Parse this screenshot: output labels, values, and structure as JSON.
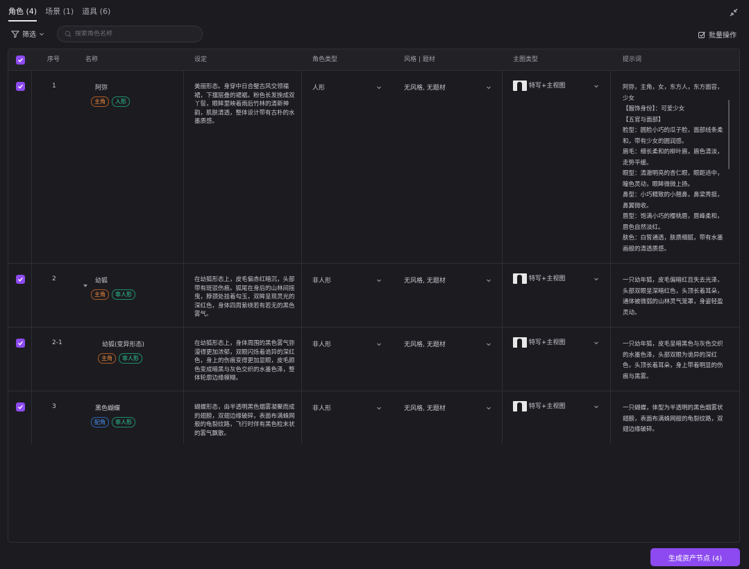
{
  "tabs": [
    {
      "label": "角色 (4)",
      "active": true
    },
    {
      "label": "场景 (1)",
      "active": false
    },
    {
      "label": "道具 (6)",
      "active": false
    }
  ],
  "toolbar": {
    "filter_label": "筛选",
    "search_placeholder": "搜索角色名称",
    "batch_label": "批量操作"
  },
  "columns": [
    "序号",
    "名称",
    "设定",
    "角色类型",
    "风格 | 题材",
    "主图类型",
    "提示词"
  ],
  "rows": [
    {
      "index": "1",
      "name": "阿弥",
      "tags": [
        {
          "text": "主角",
          "color": "orange"
        },
        {
          "text": "人形",
          "color": "green"
        }
      ],
      "setting": "美丽形态。身穿中日合璧古风交领襦裙，下摆层叠的裙裾。粉色长发挽成双丫髻，眼眸里映着雨后竹林的清新神韵，肌肤清透，整体设计带有古朴的水墨质感。",
      "role_type": "人形",
      "style": "无风格, 无题材",
      "main_type": "特写+主视图",
      "prompt": "阿弥，主角，女，东方人，东方面容，少女\n【服饰身份】：可爱少女\n【五官与面部】\n脸型：圆脸小巧的瓜子脸，面部线条柔和，带有少女的圆润感。\n眉毛：细长柔和的柳叶眉，眉色清淡，走势平缓。\n眼型：清澈明亮的杏仁眼，眼距适中，瞳色灵动，眼眸微微上扬。\n鼻型：小巧精致的小翘鼻，鼻梁秀挺，鼻翼微收。\n唇型：饱满小巧的樱桃唇，唇峰柔和，唇色自然淡红。\n肤色：白皙通透，肤质细腻，带有水墨画般的清透质感。"
    },
    {
      "index": "2",
      "name": "幼狐",
      "tags": [
        {
          "text": "主角",
          "color": "orange"
        },
        {
          "text": "非人形",
          "color": "green"
        }
      ],
      "setting": "在幼狐形态上，皮毛偏赤红暗沉，头部带有斑驳伤痕。狐尾在身后的山林间摇曳，脖颈处挂着勾玉，双眸呈现灵光的深红色，身体四周萦绕若有若无的黑色雾气。",
      "role_type": "非人形",
      "style": "无风格, 无题材",
      "main_type": "特写+主视图",
      "prompt": "一只幼年狐，皮毛偏暗红且失去光泽，头部双眼呈深暗红色，头顶长着耳朵，通体被微弱的山林灵气笼罩，身姿轻盈灵动。"
    },
    {
      "index": "2-1",
      "name": "幼狐(变异形态)",
      "tags": [
        {
          "text": "主角",
          "color": "orange"
        },
        {
          "text": "非人形",
          "color": "green"
        }
      ],
      "setting": "在幼狐形态上，身体周围的黑色雾气弥漫得更加浓郁，双眼闪烁着诡异的深红色，身上的伤痕变得更加显眼，皮毛颜色变成暗黑与灰色交织的水墨色泽，整体轮廓边缘模糊。",
      "role_type": "非人形",
      "style": "无风格, 无题材",
      "main_type": "特写+主视图",
      "prompt": "一只幼年狐，皮毛呈暗黑色与灰色交织的水墨色泽，头部双眼为诡异的深红色，头顶长着耳朵，身上带着明显的伤痕与黑雾。"
    },
    {
      "index": "3",
      "name": "黑色蝴蝶",
      "tags": [
        {
          "text": "配角",
          "color": "blue"
        },
        {
          "text": "非人形",
          "color": "green"
        }
      ],
      "setting": "蝴蝶形态，由半透明黑色烟雾凝聚而成的翅膀，双翅边缘破碎，表面布满蛛网般的龟裂纹路，飞行时伴有黑色粒末状的雾气飘散。",
      "role_type": "非人形",
      "style": "无风格, 无题材",
      "main_type": "特写+主视图",
      "prompt": "一只蝴蝶，体型为半透明的黑色烟雾状翅膀，表面布满蛛网般的龟裂纹路，双翅边缘破碎。"
    }
  ],
  "generate_button": "生成资产节点 (4)",
  "colors": {
    "accent": "#8d4af0",
    "background": "#1c1c20",
    "tag_orange": "#f08a3c",
    "tag_green": "#2fd8a0",
    "tag_blue": "#4a90f0"
  }
}
